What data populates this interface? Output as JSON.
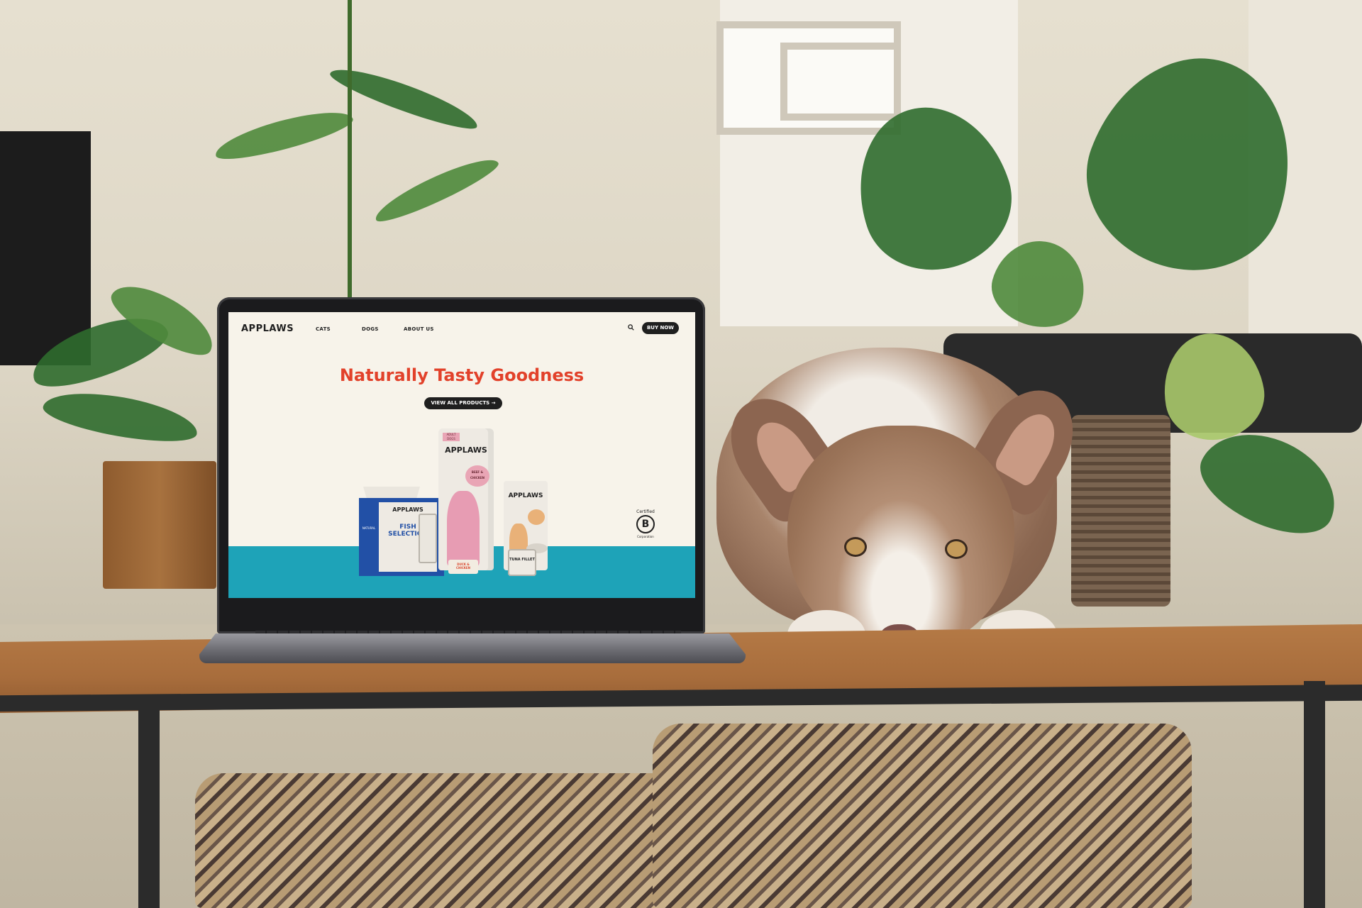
{
  "site": {
    "logo": "APPLAWS",
    "nav": [
      "CATS",
      "DOGS",
      "ABOUT US"
    ],
    "buy_label": "BUY NOW",
    "headline": "Naturally Tasty Goodness",
    "view_label": "VIEW ALL PRODUCTS →",
    "bcorp": {
      "certified": "Certified",
      "letter": "B",
      "corporation": "Corporation"
    },
    "products": {
      "bag_big_brand": "APPLAWS",
      "bag_big_flavor": "BEEF & CHICKEN",
      "bag_big_tag": "ADULT DOGS",
      "bag_small_brand": "APPLAWS",
      "box_brand": "APPLAWS",
      "box_title": "FISH SELECTION",
      "box_side": "NATURAL",
      "tuna_can": "TUNA FILLET",
      "treat": "DUCK & CHICKEN"
    },
    "colors": {
      "headline": "#e2412a",
      "band": "#1ea3b8",
      "ink": "#1f1f1f",
      "cream": "#f7f3ea",
      "box_blue": "#2250a6"
    }
  },
  "icons": [
    "search-icon",
    "arrow-right-icon",
    "bcorp-logo"
  ]
}
